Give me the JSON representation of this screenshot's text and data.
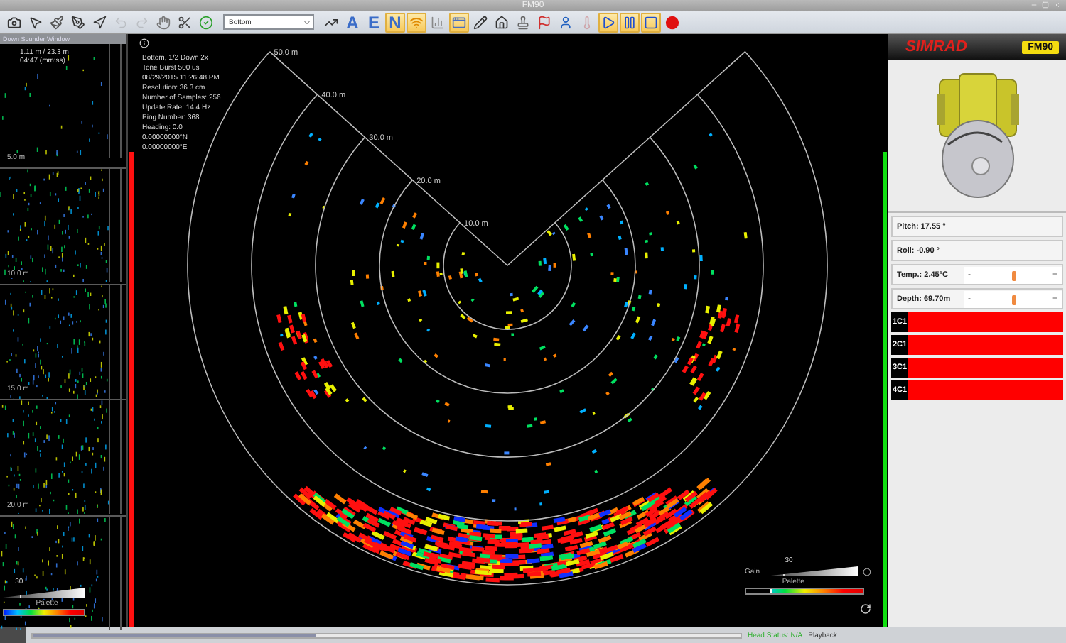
{
  "window": {
    "title": "FM90"
  },
  "toolbar": {
    "items": [
      {
        "kind": "icon",
        "active": false
      },
      {
        "kind": "icon",
        "active": false
      },
      {
        "kind": "icon",
        "active": false
      },
      {
        "kind": "icon",
        "active": false
      },
      {
        "kind": "icon",
        "active": false
      },
      {
        "kind": "icon",
        "active": false,
        "disabled": true
      },
      {
        "kind": "icon",
        "active": false,
        "disabled": true
      },
      {
        "kind": "icon",
        "active": false
      },
      {
        "kind": "icon",
        "active": false
      },
      {
        "kind": "icon",
        "active": false
      },
      {
        "kind": "select",
        "value": "Bottom"
      },
      {
        "kind": "icon",
        "active": false
      },
      {
        "kind": "letter",
        "label": "A",
        "active": false
      },
      {
        "kind": "letter",
        "label": "E",
        "active": false
      },
      {
        "kind": "letter",
        "label": "N",
        "active": true
      },
      {
        "kind": "icon",
        "active": true
      },
      {
        "kind": "icon",
        "active": false
      },
      {
        "kind": "icon",
        "active": true
      },
      {
        "kind": "icon",
        "active": false
      },
      {
        "kind": "icon",
        "active": false
      },
      {
        "kind": "icon",
        "active": false
      },
      {
        "kind": "icon",
        "active": false
      },
      {
        "kind": "icon",
        "active": false
      },
      {
        "kind": "icon",
        "active": false,
        "disabled": true
      },
      {
        "kind": "icon",
        "active": true
      },
      {
        "kind": "icon",
        "active": true
      },
      {
        "kind": "icon",
        "active": true
      },
      {
        "kind": "icon",
        "active": false
      }
    ]
  },
  "sounder": {
    "title": "Down Sounder Window",
    "range": "1.11 m / 23.3 m",
    "time": "04:47 (mm:ss)",
    "depth_marks": [
      "5.0 m",
      "10.0 m",
      "15.0 m",
      "20.0 m"
    ],
    "gain": {
      "value": "30",
      "level": 0.2
    },
    "palette": {
      "label": "Palette"
    }
  },
  "sonar": {
    "info": [
      "Bottom, 1/2 Down 2x",
      "Tone Burst 500 us",
      "08/29/2015 11:26:48 PM",
      "Resolution: 36.3 cm",
      "Number of Samples: 256",
      "Update Rate: 14.4 Hz",
      "Ping Number: 368",
      "Heading: 0.0",
      "0.00000000°N",
      "0.00000000°E"
    ],
    "ring_labels": [
      "10.0 m",
      "20.0 m",
      "30.0 m",
      "40.0 m",
      "50.0 m"
    ],
    "left_meter": {
      "level": 0.8
    },
    "right_meter": {
      "level": 0.8
    },
    "gain": {
      "label": "Gain",
      "value": "30",
      "level": 0.2
    },
    "palette": {
      "label": "Palette",
      "level": 0.22
    }
  },
  "head": {
    "brand": "SIMRAD",
    "model": "FM90",
    "readouts": [
      {
        "kind": "text",
        "label": "Pitch: 17.55 °"
      },
      {
        "kind": "text",
        "label": "Roll: -0.90 °"
      },
      {
        "kind": "slider",
        "label": "Temp.: 2.45°C",
        "minus": "-",
        "plus": "+",
        "level": 0.5
      },
      {
        "kind": "slider",
        "label": "Depth: 69.70m",
        "minus": "-",
        "plus": "+",
        "level": 0.5
      }
    ],
    "channels": [
      {
        "label": "1C1",
        "level": 1
      },
      {
        "label": "2C1",
        "level": 1
      },
      {
        "label": "3C1",
        "level": 1
      },
      {
        "label": "4C1",
        "level": 1
      }
    ]
  },
  "status_bar": {
    "progress": {
      "level": 0.4
    },
    "status": "Head Status: N/A",
    "mode": "Playback"
  }
}
